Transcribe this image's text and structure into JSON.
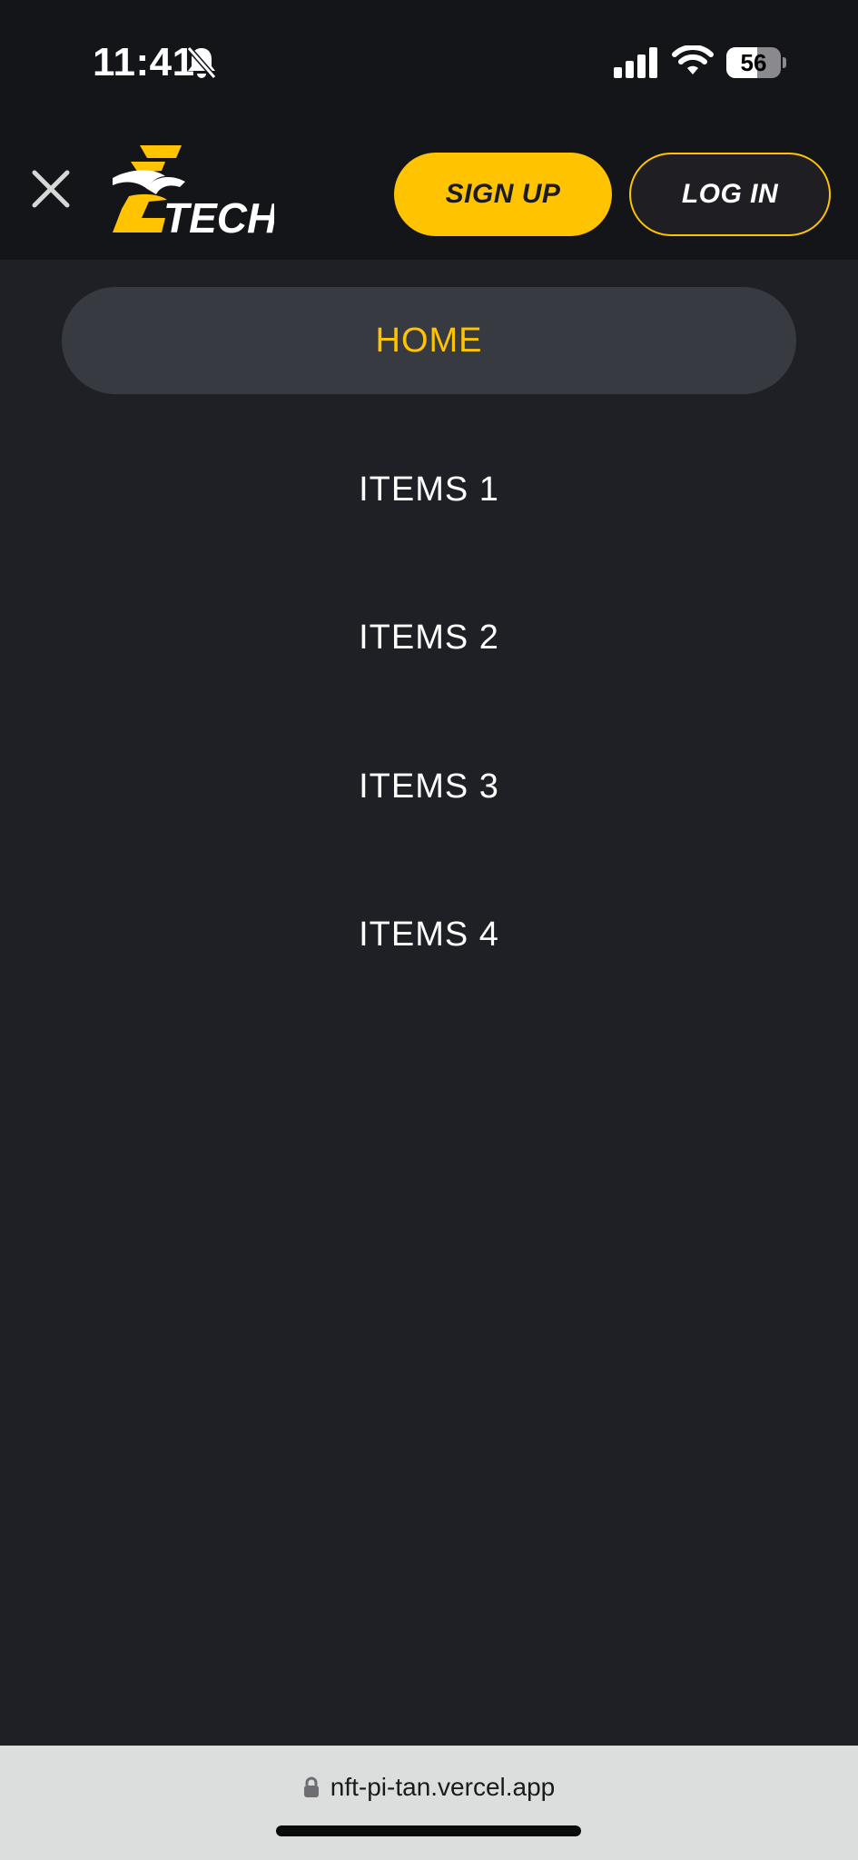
{
  "status_bar": {
    "time": "11:41",
    "battery_level": "56",
    "battery_fraction": 0.56
  },
  "header": {
    "logo_text": "TECH",
    "signup_label": "SIGN UP",
    "login_label": "LOG IN"
  },
  "menu": {
    "items": [
      {
        "label": "HOME",
        "active": true
      },
      {
        "label": "ITEMS 1",
        "active": false
      },
      {
        "label": "ITEMS 2",
        "active": false
      },
      {
        "label": "ITEMS 3",
        "active": false
      },
      {
        "label": "ITEMS 4",
        "active": false
      }
    ]
  },
  "browser": {
    "url": "nft-pi-tan.vercel.app"
  },
  "colors": {
    "accent": "#ffc300",
    "background": "#1f2025",
    "header": "#141518",
    "active_item": "#383a42"
  },
  "icons": [
    "close-icon",
    "bell-off-icon",
    "signal-icon",
    "wifi-icon",
    "battery-icon",
    "lock-icon",
    "eagle-logo"
  ]
}
